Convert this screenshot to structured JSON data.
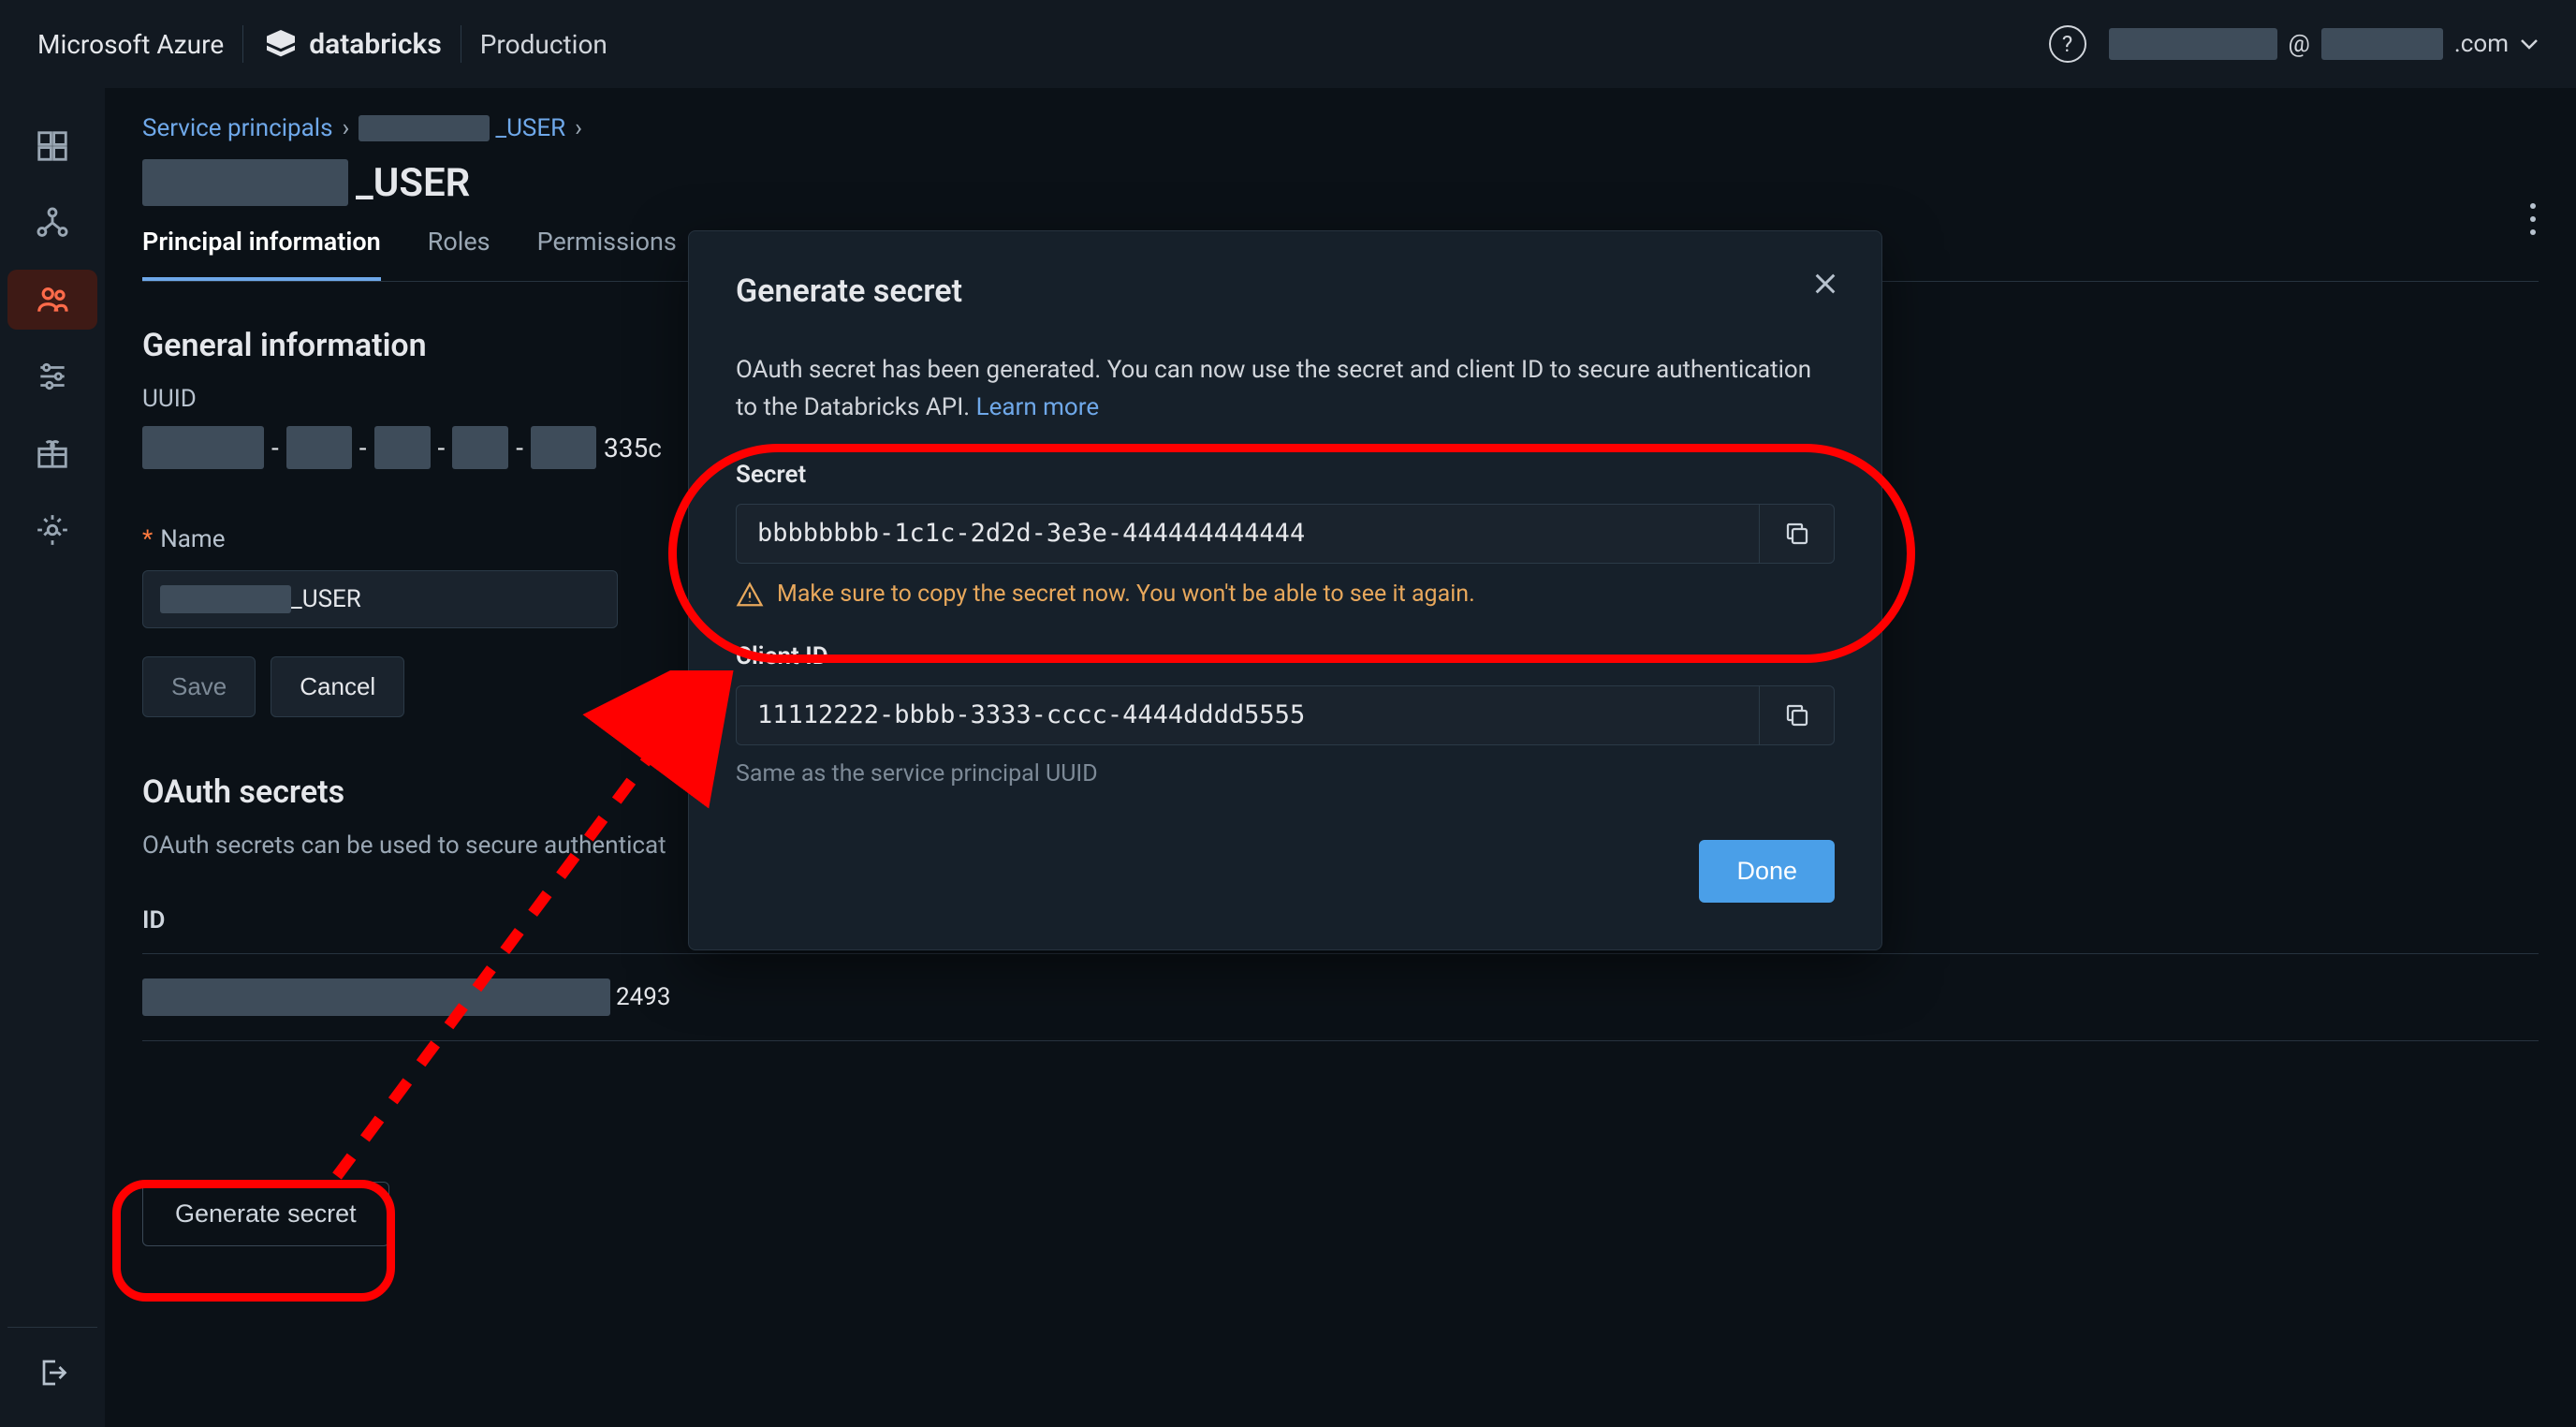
{
  "topbar": {
    "azure": "Microsoft Azure",
    "databricks": "databricks",
    "env": "Production",
    "user_at": "@",
    "user_domain": ".com"
  },
  "breadcrumb": {
    "root": "Service principals",
    "current_suffix": "_USER"
  },
  "page_title_suffix": "_USER",
  "tabs": {
    "principal": "Principal information",
    "roles": "Roles",
    "permissions": "Permissions"
  },
  "general": {
    "heading": "General information",
    "uuid_label": "UUID",
    "uuid_tail": "335c",
    "name_label": "Name",
    "name_suffix": "_USER",
    "save": "Save",
    "cancel": "Cancel"
  },
  "oauth": {
    "heading": "OAuth secrets",
    "desc": "OAuth secrets can be used to secure authenticat",
    "id_header": "ID",
    "row_tail": "2493",
    "generate": "Generate secret"
  },
  "modal": {
    "title": "Generate secret",
    "desc1": "OAuth secret has been generated. You can now use the secret and client ID to secure authentication to the Databricks API. ",
    "learn_more": "Learn more",
    "secret_label": "Secret",
    "secret_value": "bbbbbbbb-1c1c-2d2d-3e3e-444444444444",
    "warn": "Make sure to copy the secret now. You won't be able to see it again.",
    "client_id_label": "Client ID",
    "client_id_value": "11112222-bbbb-3333-cccc-4444dddd5555",
    "client_note": "Same as the service principal UUID",
    "done": "Done"
  },
  "annotation": {
    "arrow_note": "points from Generate secret button to Secret field highlight"
  }
}
